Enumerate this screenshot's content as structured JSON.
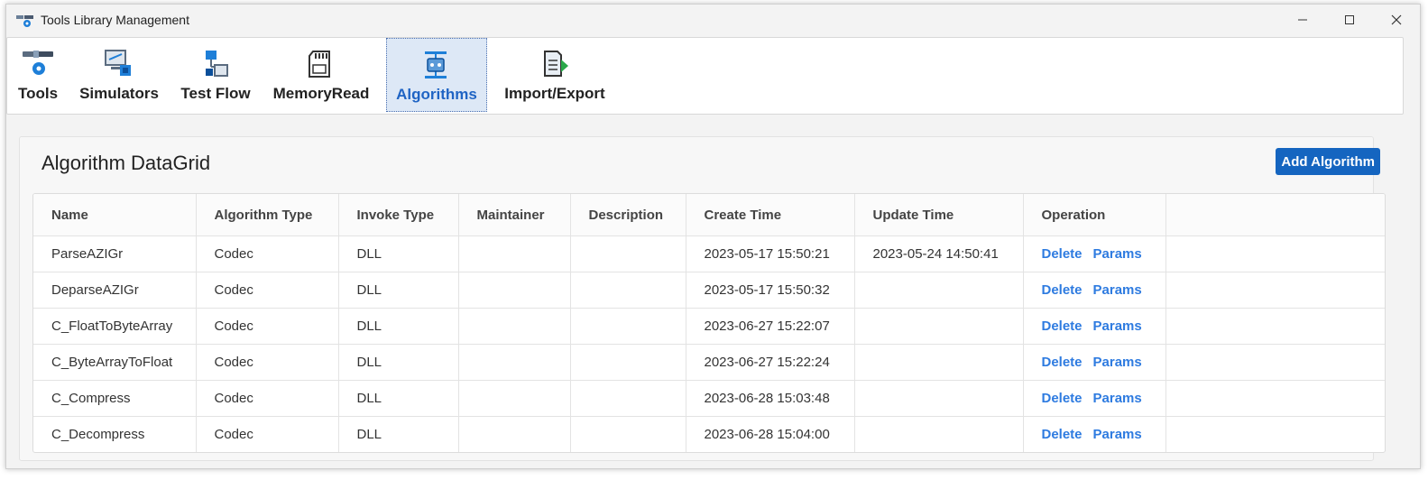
{
  "window": {
    "title": "Tools Library Management",
    "controls": {
      "minimize": "—",
      "maximize": "☐",
      "close": "✕"
    }
  },
  "ribbon": {
    "tabs": [
      {
        "label": "Tools",
        "icon": "tools-icon"
      },
      {
        "label": "Simulators",
        "icon": "simulators-icon"
      },
      {
        "label": "Test Flow",
        "icon": "test-flow-icon"
      },
      {
        "label": "MemoryRead",
        "icon": "memory-card-icon"
      },
      {
        "label": "Algorithms",
        "icon": "algorithms-icon",
        "active": true
      },
      {
        "label": "Import/Export",
        "icon": "import-export-icon"
      }
    ]
  },
  "panel": {
    "title": "Algorithm DataGrid",
    "add_button": "Add Algorithm"
  },
  "grid": {
    "columns": [
      "Name",
      "Algorithm Type",
      "Invoke Type",
      "Maintainer",
      "Description",
      "Create Time",
      "Update Time",
      "Operation"
    ],
    "rows": [
      {
        "name": "ParseAZIGr",
        "algorithm_type": "Codec",
        "invoke_type": "DLL",
        "maintainer": "",
        "description": "",
        "create_time": "2023-05-17 15:50:21",
        "update_time": "2023-05-24 14:50:41"
      },
      {
        "name": "DeparseAZIGr",
        "algorithm_type": "Codec",
        "invoke_type": "DLL",
        "maintainer": "",
        "description": "",
        "create_time": "2023-05-17 15:50:32",
        "update_time": ""
      },
      {
        "name": "C_FloatToByteArray",
        "algorithm_type": "Codec",
        "invoke_type": "DLL",
        "maintainer": "",
        "description": "",
        "create_time": "2023-06-27 15:22:07",
        "update_time": ""
      },
      {
        "name": "C_ByteArrayToFloat",
        "algorithm_type": "Codec",
        "invoke_type": "DLL",
        "maintainer": "",
        "description": "",
        "create_time": "2023-06-27 15:22:24",
        "update_time": ""
      },
      {
        "name": "C_Compress",
        "algorithm_type": "Codec",
        "invoke_type": "DLL",
        "maintainer": "",
        "description": "",
        "create_time": "2023-06-28 15:03:48",
        "update_time": ""
      },
      {
        "name": "C_Decompress",
        "algorithm_type": "Codec",
        "invoke_type": "DLL",
        "maintainer": "",
        "description": "",
        "create_time": "2023-06-28 15:04:00",
        "update_time": ""
      }
    ],
    "operations": {
      "delete": "Delete",
      "params": "Params"
    }
  },
  "colors": {
    "accent": "#1565c0",
    "link": "#2e7be0",
    "active_tab_text": "#1f64c4"
  }
}
